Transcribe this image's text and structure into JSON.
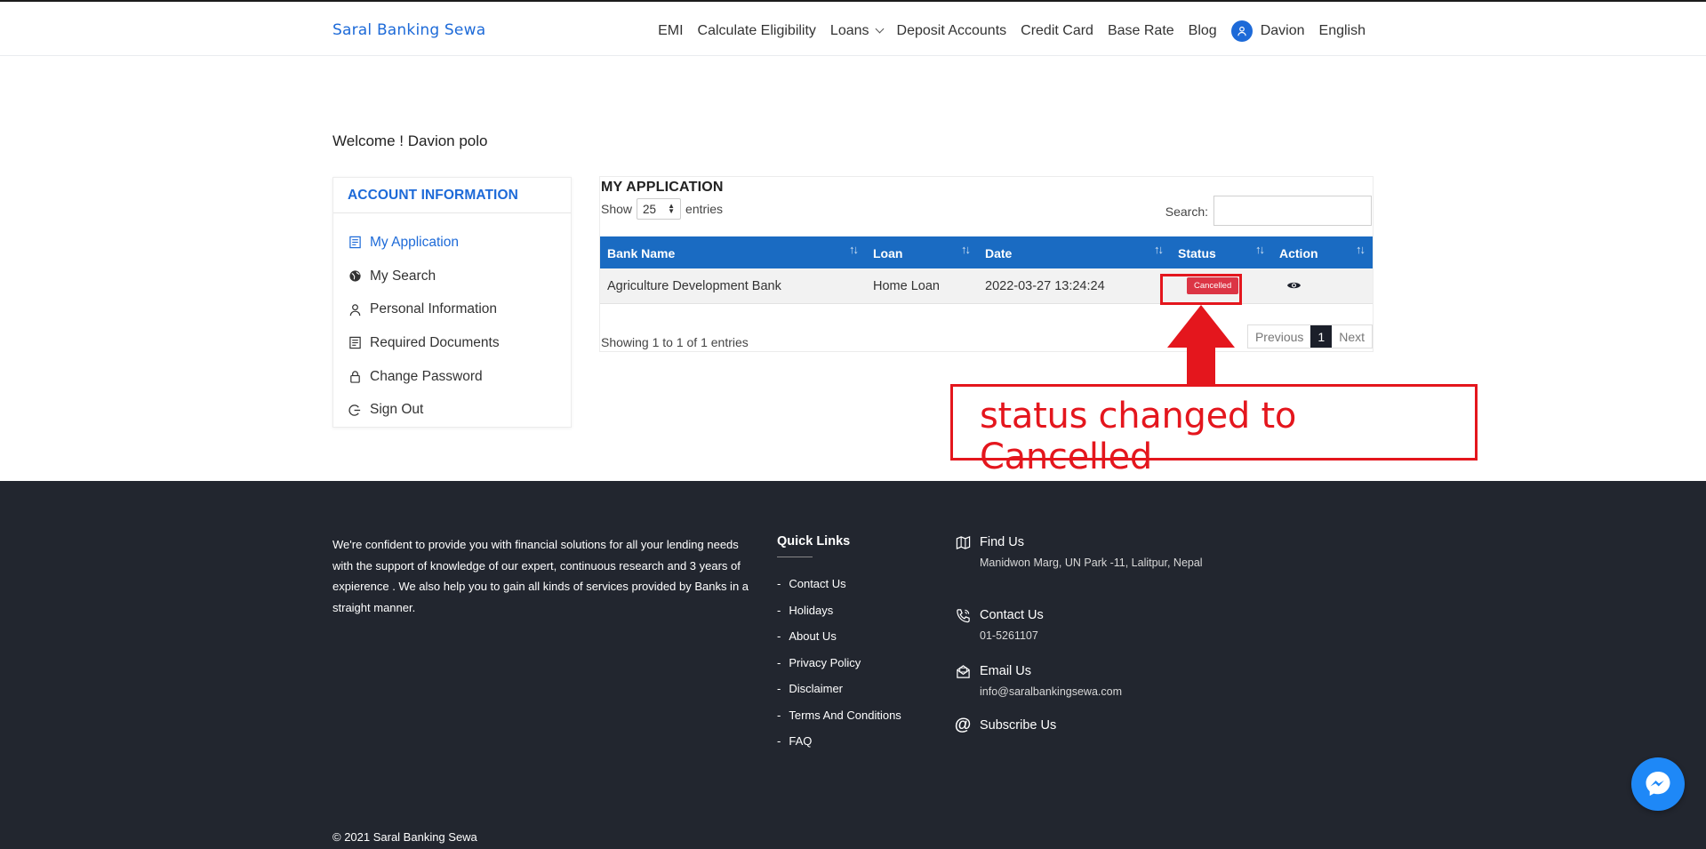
{
  "header": {
    "brand": "Saral Banking Sewa",
    "nav": [
      {
        "label": "EMI"
      },
      {
        "label": "Calculate Eligibility"
      },
      {
        "label": "Loans"
      },
      {
        "label": "Deposit Accounts"
      },
      {
        "label": "Credit Card"
      },
      {
        "label": "Base Rate"
      },
      {
        "label": "Blog"
      }
    ],
    "user": "Davion",
    "language": "English"
  },
  "welcome": "Welcome ! Davion polo",
  "sidebar": {
    "title": "ACCOUNT INFORMATION",
    "items": [
      {
        "label": "My Application",
        "icon": "application-icon",
        "active": true
      },
      {
        "label": "My Search",
        "icon": "globe-icon"
      },
      {
        "label": "Personal Information",
        "icon": "user-icon"
      },
      {
        "label": "Required Documents",
        "icon": "documents-icon"
      },
      {
        "label": "Change Password",
        "icon": "lock-icon"
      },
      {
        "label": "Sign Out",
        "icon": "sign-out-icon"
      }
    ]
  },
  "application": {
    "title": "MY APPLICATION",
    "show_label": "Show",
    "entries_value": "25",
    "entries_label": "entries",
    "search_label": "Search:",
    "search_value": "",
    "columns": [
      "Bank Name",
      "Loan",
      "Date",
      "Status",
      "Action"
    ],
    "rows": [
      {
        "bank": "Agriculture Development Bank",
        "loan": "Home Loan",
        "date": "2022-03-27 13:24:24",
        "status": "Cancelled",
        "action_icon": "eye-icon"
      }
    ],
    "showing": "Showing 1 to 1 of 1 entries",
    "pagination": {
      "previous": "Previous",
      "current": "1",
      "next": "Next"
    }
  },
  "annotation": {
    "text": "status changed to Cancelled",
    "color": "#e4161d"
  },
  "footer": {
    "about": "We're confident to provide you with financial solutions for all your lending needs with the support of knowledge of our expert, continuous research and 3 years of expierence . We also help you to gain all kinds of services provided by Banks in a straight manner.",
    "quick_links_title": "Quick Links",
    "quick_links": [
      "Contact Us",
      "Holidays",
      "About Us",
      "Privacy Policy",
      "Disclaimer",
      "Terms And Conditions",
      "FAQ"
    ],
    "find_us_title": "Find Us",
    "find_us_text": "Manidwon Marg, UN Park -11, Lalitpur, Nepal",
    "contact_title": "Contact Us",
    "contact_text": "01-5261107",
    "email_title": "Email Us",
    "email_text": "info@saralbankingsewa.com",
    "subscribe_title": "Subscribe Us",
    "copyright": "© 2021 Saral Banking Sewa"
  },
  "colors": {
    "brand_blue": "#1d6ad8",
    "table_header": "#1a6bc2",
    "status_cancelled": "#dc3545",
    "footer_bg": "#22262f",
    "messenger": "#1e88f7"
  }
}
